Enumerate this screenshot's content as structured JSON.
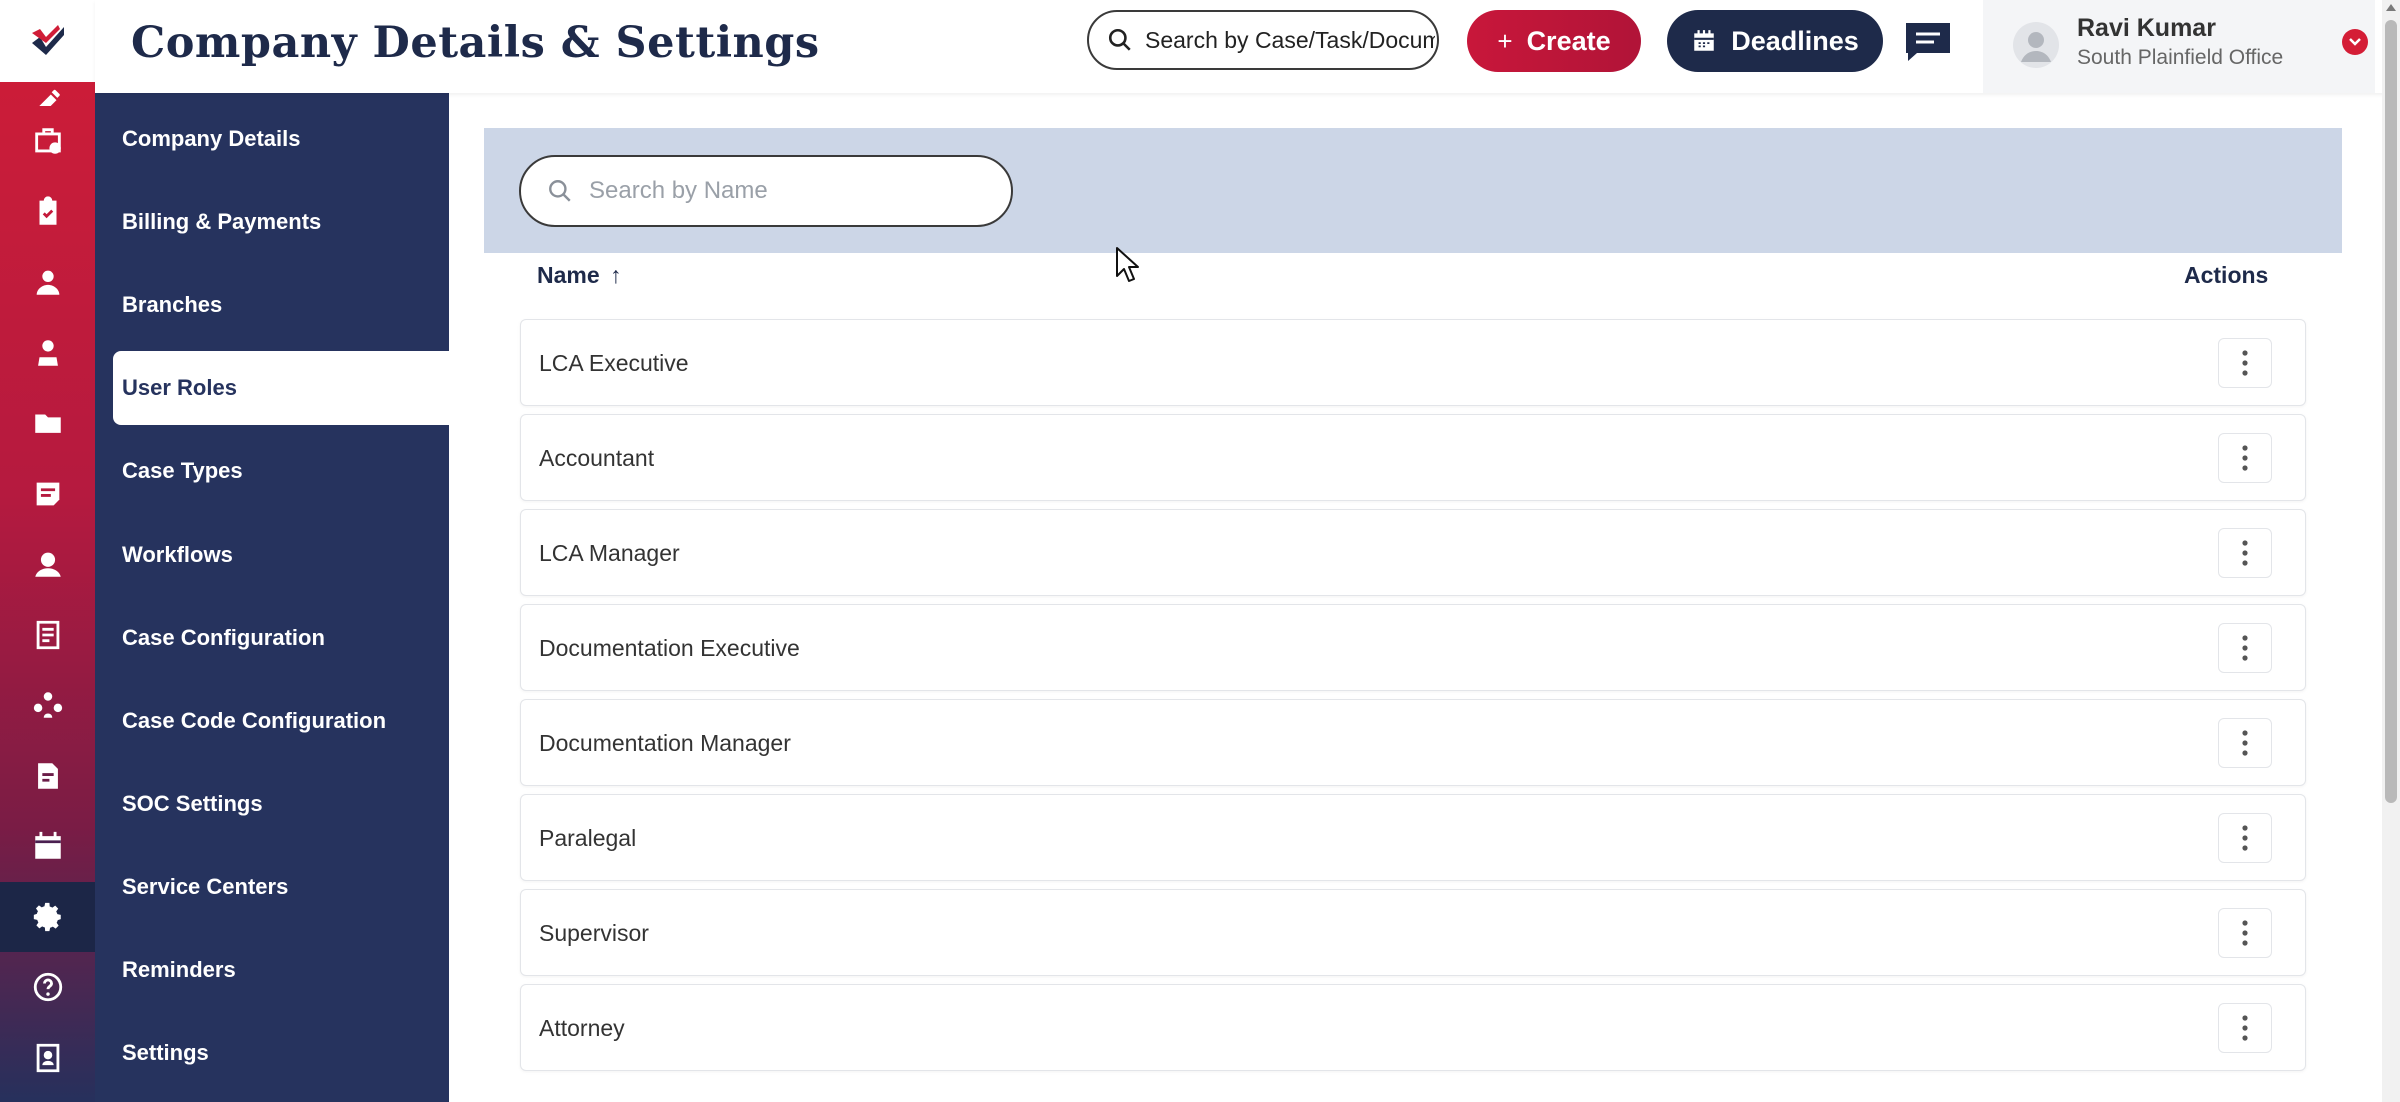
{
  "header": {
    "title": "Company Details & Settings",
    "global_search_placeholder": "Search by Case/Task/Document",
    "create_label": "Create",
    "deadlines_label": "Deadlines"
  },
  "user": {
    "name": "Ravi Kumar",
    "office": "South Plainfield Office"
  },
  "rail": {
    "icons": [
      "edit-icon",
      "cases-icon",
      "clipboard-icon",
      "person-icon",
      "beneficiary-icon",
      "folder-icon",
      "notes-icon",
      "agent-icon",
      "ledger-icon",
      "team-icon",
      "document-edit-icon",
      "calendar-icon",
      "gear-icon",
      "help-icon",
      "contacts-book-icon"
    ],
    "active": "gear-icon"
  },
  "sidebar": {
    "items": [
      {
        "label": "Company Details"
      },
      {
        "label": "Billing & Payments"
      },
      {
        "label": "Branches"
      },
      {
        "label": "User Roles",
        "active": true
      },
      {
        "label": "Case Types"
      },
      {
        "label": "Workflows"
      },
      {
        "label": "Case Configuration"
      },
      {
        "label": "Case Code Configuration"
      },
      {
        "label": "SOC Settings"
      },
      {
        "label": "Service Centers"
      },
      {
        "label": "Reminders"
      },
      {
        "label": "Settings"
      }
    ]
  },
  "main": {
    "search_placeholder": "Search by Name",
    "columns": {
      "name": "Name",
      "actions": "Actions"
    },
    "roles": [
      "LCA Executive",
      "Accountant",
      "LCA Manager",
      "Documentation Executive",
      "Documentation Manager",
      "Paralegal",
      "Supervisor",
      "Attorney"
    ]
  },
  "colors": {
    "brand_red": "#c8173a",
    "navy": "#1e2a4a",
    "sidebar": "#26335e",
    "filter_band": "#ccd6e7"
  }
}
